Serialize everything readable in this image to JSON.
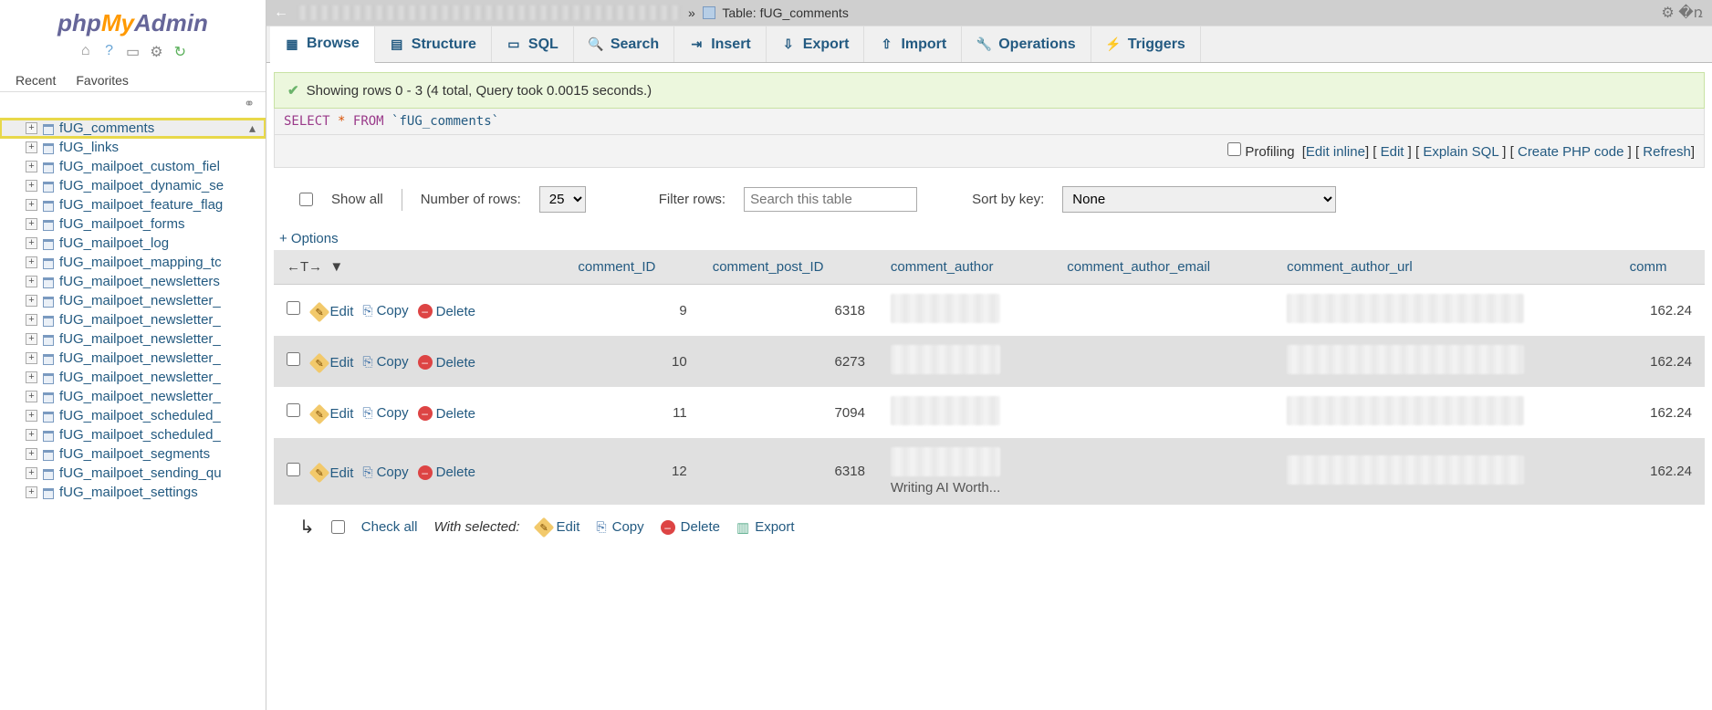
{
  "logo": {
    "php": "php",
    "my": "My",
    "admin": "Admin"
  },
  "sidebar": {
    "tabs": {
      "recent": "Recent",
      "favorites": "Favorites"
    },
    "items": [
      {
        "label": "fUG_comments",
        "selected": true
      },
      {
        "label": "fUG_links"
      },
      {
        "label": "fUG_mailpoet_custom_fiel"
      },
      {
        "label": "fUG_mailpoet_dynamic_se"
      },
      {
        "label": "fUG_mailpoet_feature_flag"
      },
      {
        "label": "fUG_mailpoet_forms"
      },
      {
        "label": "fUG_mailpoet_log"
      },
      {
        "label": "fUG_mailpoet_mapping_tc"
      },
      {
        "label": "fUG_mailpoet_newsletters"
      },
      {
        "label": "fUG_mailpoet_newsletter_"
      },
      {
        "label": "fUG_mailpoet_newsletter_"
      },
      {
        "label": "fUG_mailpoet_newsletter_"
      },
      {
        "label": "fUG_mailpoet_newsletter_"
      },
      {
        "label": "fUG_mailpoet_newsletter_"
      },
      {
        "label": "fUG_mailpoet_newsletter_"
      },
      {
        "label": "fUG_mailpoet_scheduled_"
      },
      {
        "label": "fUG_mailpoet_scheduled_"
      },
      {
        "label": "fUG_mailpoet_segments"
      },
      {
        "label": "fUG_mailpoet_sending_qu"
      },
      {
        "label": "fUG_mailpoet_settings"
      }
    ]
  },
  "topbar": {
    "crumb_prefix": "» ",
    "table_label": "Table: ",
    "table_name": "fUG_comments"
  },
  "tabs": [
    {
      "name": "browse",
      "label": "Browse",
      "active": true,
      "icon": "▦"
    },
    {
      "name": "structure",
      "label": "Structure",
      "icon": "▤"
    },
    {
      "name": "sql",
      "label": "SQL",
      "icon": "▭"
    },
    {
      "name": "search",
      "label": "Search",
      "icon": "🔍"
    },
    {
      "name": "insert",
      "label": "Insert",
      "icon": "⇥"
    },
    {
      "name": "export",
      "label": "Export",
      "icon": "⇩"
    },
    {
      "name": "import",
      "label": "Import",
      "icon": "⇧"
    },
    {
      "name": "operations",
      "label": "Operations",
      "icon": "🔧"
    },
    {
      "name": "triggers",
      "label": "Triggers",
      "icon": "⚡"
    }
  ],
  "message": "Showing rows 0 - 3 (4 total, Query took 0.0015 seconds.)",
  "sql": {
    "select": "SELECT",
    "star": "*",
    "from": "FROM",
    "table": "`fUG_comments`"
  },
  "sql_actions": {
    "profiling": "Profiling",
    "edit_inline": "Edit inline",
    "edit": "Edit",
    "explain": "Explain SQL",
    "create_php": "Create PHP code",
    "refresh": "Refresh"
  },
  "controls": {
    "show_all": "Show all",
    "numrows_label": "Number of rows:",
    "numrows_value": "25",
    "filter_label": "Filter rows:",
    "filter_placeholder": "Search this table",
    "sort_label": "Sort by key:",
    "sort_value": "None"
  },
  "options_link": "+ Options",
  "columns": [
    "comment_ID",
    "comment_post_ID",
    "comment_author",
    "comment_author_email",
    "comment_author_url",
    "comm"
  ],
  "row_actions": {
    "edit": "Edit",
    "copy": "Copy",
    "delete": "Delete"
  },
  "rows": [
    {
      "comment_ID": "9",
      "comment_post_ID": "6318",
      "col6": "162.24"
    },
    {
      "comment_ID": "10",
      "comment_post_ID": "6273",
      "col6": "162.24"
    },
    {
      "comment_ID": "11",
      "comment_post_ID": "7094",
      "col6": "162.24"
    },
    {
      "comment_ID": "12",
      "comment_post_ID": "6318",
      "col6": "162.24"
    }
  ],
  "row3_author_fragment": "Writing AI Worth...",
  "footer": {
    "check_all": "Check all",
    "with_selected": "With selected:",
    "edit": "Edit",
    "copy": "Copy",
    "delete": "Delete",
    "export": "Export"
  }
}
